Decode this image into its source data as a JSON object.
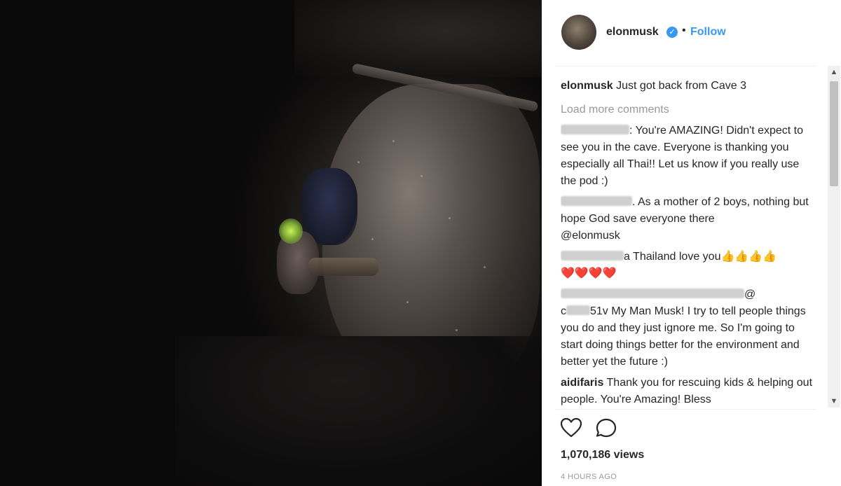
{
  "post": {
    "username": "elonmusk",
    "separator": "•",
    "follow_label": "Follow",
    "caption": "Just got back from Cave 3",
    "load_more_label": "Load more comments",
    "views": "1,070,186 views",
    "timestamp": "4 HOURS AGO"
  },
  "comments": [
    {
      "text": ": You're AMAZING! Didn't expect to see you in the cave. Everyone is thanking you especially all Thai!! Let us know if you really use the pod :)"
    },
    {
      "text": ". As a mother of 2 boys, nothing but hope God save everyone there",
      "mention": "@elonmusk"
    },
    {
      "text": "a Thailand love you👍👍👍👍",
      "line2": "❤️❤️❤️❤️"
    },
    {
      "at": "@",
      "prefix": "c",
      "suffix": "51v",
      "text": " My Man Musk! I try to tell people things you do and they just ignore me. So I'm going to start doing things better for the environment and better yet the future :)"
    },
    {
      "user": "aidifaris",
      "text": " Thank you for rescuing kids & helping out people. You're Amazing! Bless"
    }
  ],
  "icons": {
    "verified": "verified-badge-icon",
    "like": "heart-icon",
    "comment": "comment-bubble-icon",
    "scroll_up": "chevron-up-icon",
    "scroll_down": "chevron-down-icon"
  },
  "colors": {
    "accent": "#3897f0",
    "text": "#262626",
    "muted": "#999999"
  }
}
